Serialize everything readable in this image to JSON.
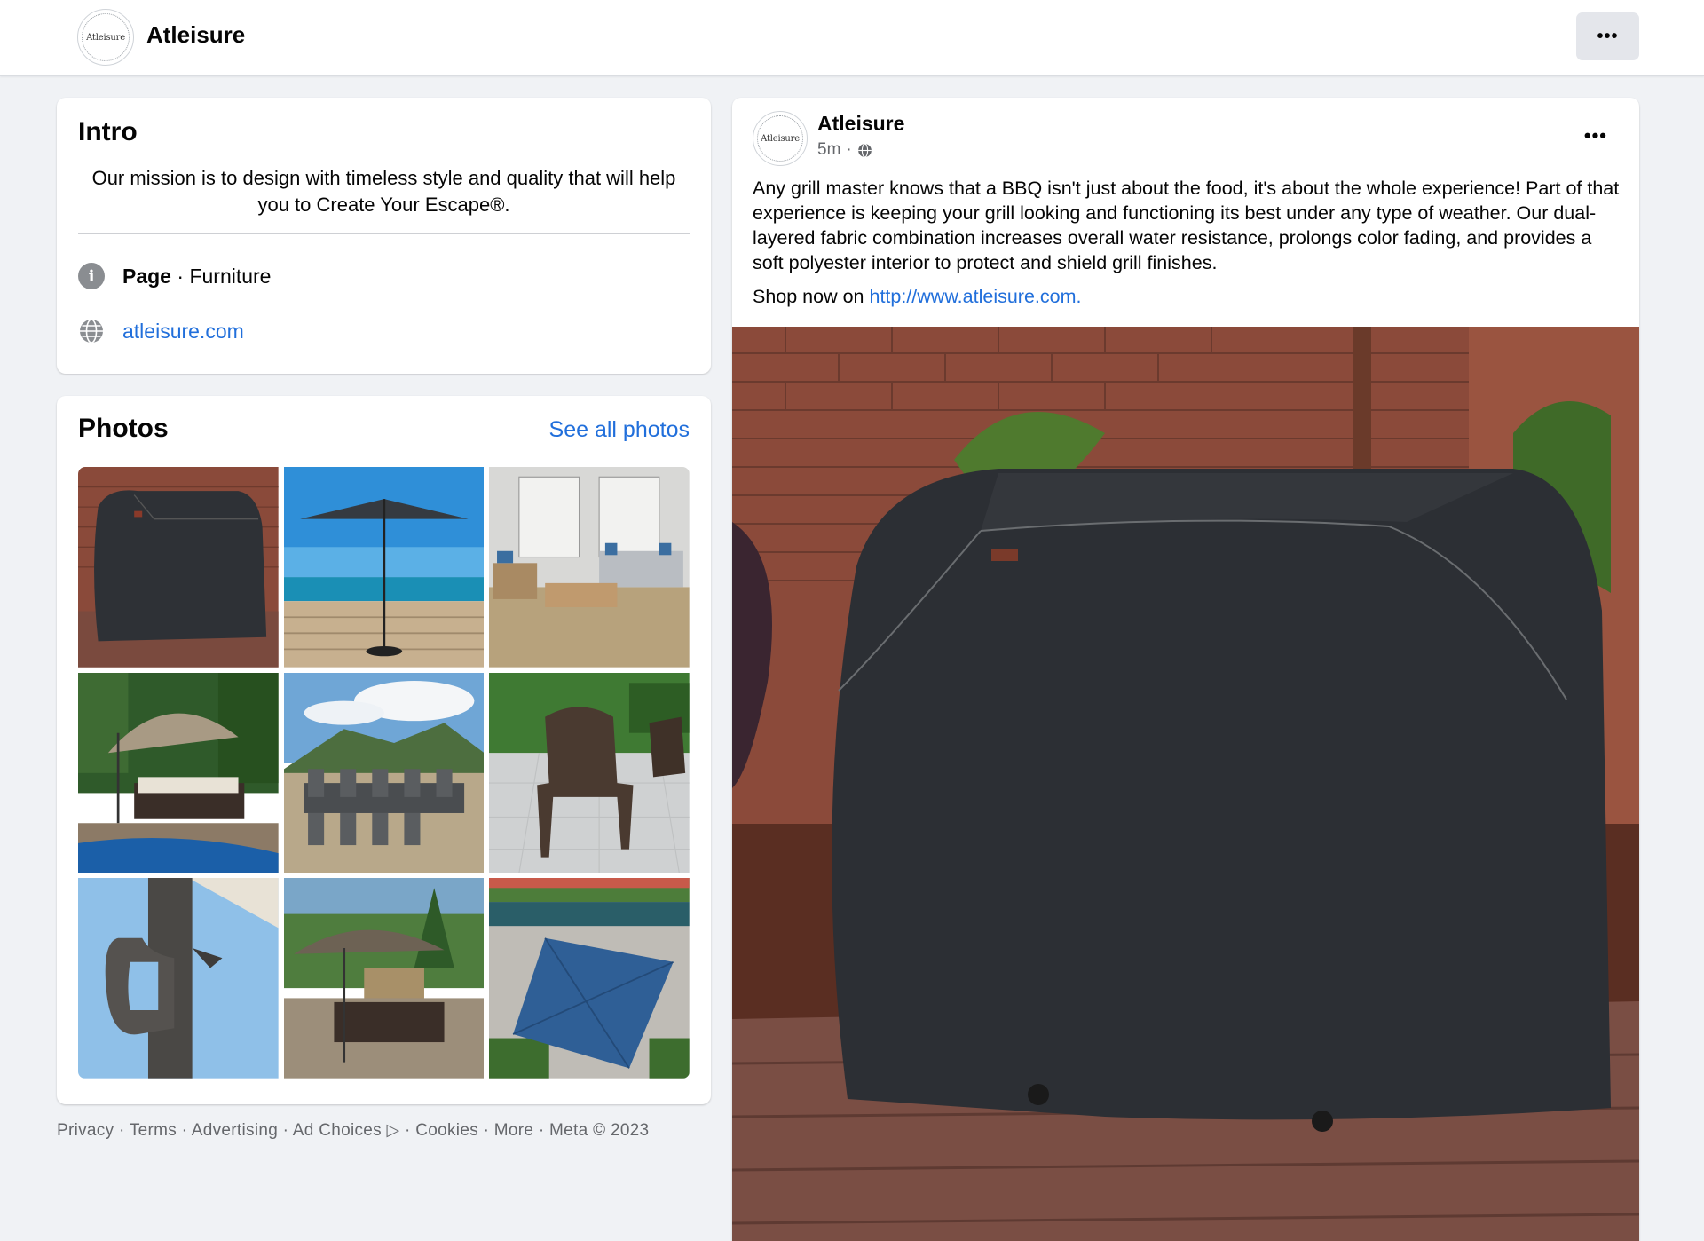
{
  "header": {
    "brand_name": "Atleisure",
    "logo_text": "Atleisure",
    "more_icon": "more-horizontal-icon"
  },
  "intro": {
    "title": "Intro",
    "mission": "Our mission is to design with timeless style and quality that will help you to Create Your Escape®.",
    "category_label": "Page",
    "category_separator": " · ",
    "category_value": "Furniture",
    "website": "atleisure.com",
    "info_icon": "info-icon",
    "globe_icon": "globe-icon"
  },
  "photos": {
    "title": "Photos",
    "see_all": "See all photos",
    "items": [
      {
        "name": "grill-cover-photo"
      },
      {
        "name": "umbrella-ocean-deck-photo"
      },
      {
        "name": "patio-sofa-set-photo"
      },
      {
        "name": "cantilever-umbrella-pool-photo"
      },
      {
        "name": "dining-set-mountains-photo"
      },
      {
        "name": "wicker-chair-photo"
      },
      {
        "name": "umbrella-crank-handle-photo"
      },
      {
        "name": "umbrella-dining-garden-photo"
      },
      {
        "name": "blue-umbrella-overhead-photo"
      }
    ]
  },
  "footer": {
    "text": "Privacy · Terms · Advertising · Ad Choices ▷ · Cookies · More · Meta © 2023"
  },
  "post": {
    "author": "Atleisure",
    "time": "5m",
    "separator": "·",
    "audience_icon": "globe-icon",
    "body": "Any grill master knows that a BBQ isn't just about the food, it's about the whole experience! Part of that experience is keeping your grill looking and functioning its best under any type of weather. Our dual-layered fabric combination increases overall water resistance, prolongs color fading, and provides a soft polyester interior to protect and shield grill finishes.",
    "shop_prefix": "Shop now on ",
    "shop_link": "http://www.atleisure.com.",
    "image_name": "grill-cover-main-photo"
  },
  "colors": {
    "link": "#216fdb",
    "background": "#f0f2f5",
    "secondary_text": "#65676b"
  }
}
